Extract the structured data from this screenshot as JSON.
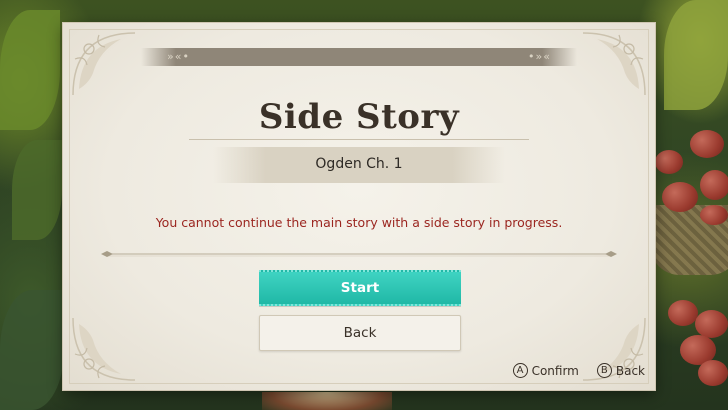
{
  "dialog": {
    "title": "Side Story",
    "subtitle": "Ogden Ch. 1",
    "warning": "You cannot continue the main story with a side story in progress.",
    "band_mark_left": "»«•",
    "band_mark_right": "•»«",
    "buttons": {
      "start_label": "Start",
      "back_label": "Back"
    },
    "accent_color": "#20b8a6",
    "warning_color": "#9b2620"
  },
  "hints": {
    "confirm": {
      "button": "A",
      "label": "Confirm"
    },
    "back": {
      "button": "B",
      "label": "Back"
    }
  }
}
